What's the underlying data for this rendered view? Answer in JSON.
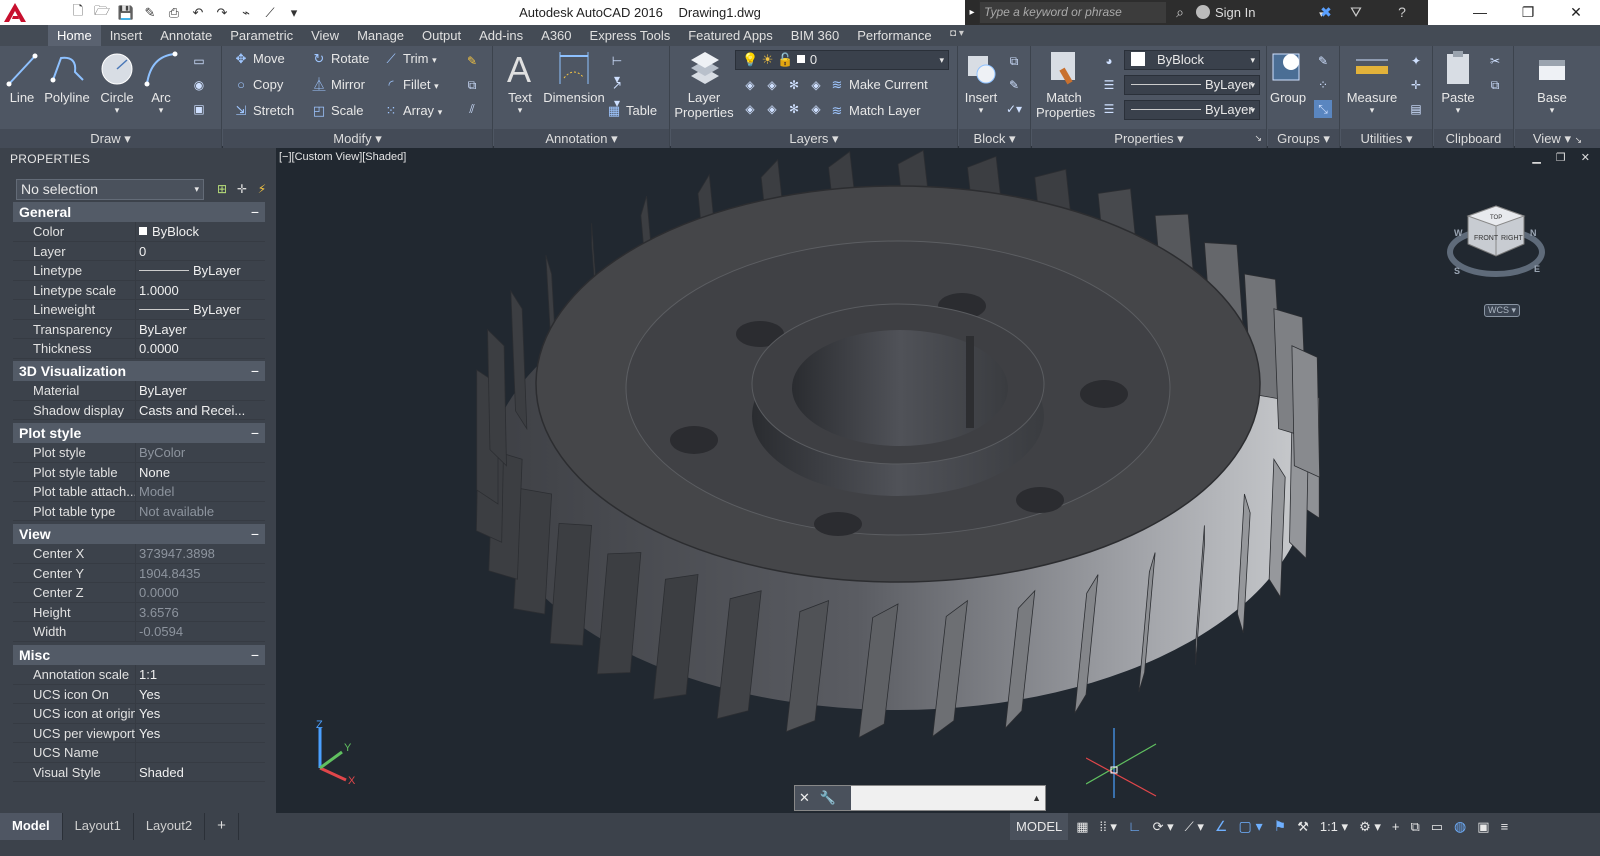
{
  "titlebar": {
    "app_name": "Autodesk AutoCAD 2016",
    "document": "Drawing1.dwg",
    "search_placeholder": "Type a keyword or phrase",
    "sign_in": "Sign In"
  },
  "ribbon_tabs": [
    "Home",
    "Insert",
    "Annotate",
    "Parametric",
    "View",
    "Manage",
    "Output",
    "Add-ins",
    "A360",
    "Express Tools",
    "Featured Apps",
    "BIM 360",
    "Performance"
  ],
  "ribbon": {
    "draw": {
      "title": "Draw",
      "line": "Line",
      "polyline": "Polyline",
      "circle": "Circle",
      "arc": "Arc"
    },
    "modify": {
      "title": "Modify",
      "move": "Move",
      "rotate": "Rotate",
      "trim": "Trim",
      "copy": "Copy",
      "mirror": "Mirror",
      "fillet": "Fillet",
      "stretch": "Stretch",
      "scale": "Scale",
      "array": "Array"
    },
    "annotation": {
      "title": "Annotation",
      "text": "Text",
      "dimension": "Dimension",
      "table": "Table"
    },
    "layers": {
      "title": "Layers",
      "layer_properties_1": "Layer",
      "layer_properties_2": "Properties",
      "current_layer": "0",
      "make_current": "Make Current",
      "match_layer": "Match Layer"
    },
    "block": {
      "title": "Block",
      "insert": "Insert"
    },
    "properties": {
      "title": "Properties",
      "match_1": "Match",
      "match_2": "Properties",
      "color": "ByBlock",
      "linetype": "ByLayer",
      "lineweight": "ByLayer"
    },
    "groups": {
      "title": "Groups",
      "group": "Group"
    },
    "utilities": {
      "title": "Utilities",
      "measure": "Measure"
    },
    "clipboard": {
      "title": "Clipboard",
      "paste": "Paste"
    },
    "view": {
      "title": "View",
      "base": "Base"
    }
  },
  "properties": {
    "header": "PROPERTIES",
    "selection": "No selection",
    "sections": {
      "general": "General",
      "visualization": "3D Visualization",
      "plot_style": "Plot style",
      "view": "View",
      "misc": "Misc"
    },
    "general": [
      {
        "name": "Color",
        "value": "ByBlock"
      },
      {
        "name": "Layer",
        "value": "0"
      },
      {
        "name": "Linetype",
        "value": "ByLayer"
      },
      {
        "name": "Linetype scale",
        "value": "1.0000"
      },
      {
        "name": "Lineweight",
        "value": "ByLayer"
      },
      {
        "name": "Transparency",
        "value": "ByLayer"
      },
      {
        "name": "Thickness",
        "value": "0.0000"
      }
    ],
    "visualization": [
      {
        "name": "Material",
        "value": "ByLayer"
      },
      {
        "name": "Shadow display",
        "value": "Casts and Recei..."
      }
    ],
    "plot_style": [
      {
        "name": "Plot style",
        "value": "ByColor"
      },
      {
        "name": "Plot style table",
        "value": "None"
      },
      {
        "name": "Plot table attach...",
        "value": "Model"
      },
      {
        "name": "Plot table type",
        "value": "Not available"
      }
    ],
    "view": [
      {
        "name": "Center X",
        "value": "373947.3898"
      },
      {
        "name": "Center Y",
        "value": "1904.8435"
      },
      {
        "name": "Center Z",
        "value": "0.0000"
      },
      {
        "name": "Height",
        "value": "3.6576"
      },
      {
        "name": "Width",
        "value": "-0.0594"
      }
    ],
    "misc": [
      {
        "name": "Annotation scale",
        "value": "1:1"
      },
      {
        "name": "UCS icon On",
        "value": "Yes"
      },
      {
        "name": "UCS icon at origin",
        "value": "Yes"
      },
      {
        "name": "UCS per viewport",
        "value": "Yes"
      },
      {
        "name": "UCS Name",
        "value": ""
      },
      {
        "name": "Visual Style",
        "value": "Shaded"
      }
    ]
  },
  "viewport": {
    "label": "[−][Custom View][Shaded]",
    "wcs": "WCS",
    "viewcube": {
      "top": "TOP",
      "front": "FRONT",
      "right": "RIGHT",
      "n": "N",
      "s": "S",
      "e": "E",
      "w": "W"
    },
    "ucs_axes": {
      "x": "X",
      "y": "Y",
      "z": "Z"
    }
  },
  "statusbar": {
    "tabs": [
      "Model",
      "Layout1",
      "Layout2"
    ],
    "model_label": "MODEL",
    "scale": "1:1"
  },
  "colors": {
    "viewport_bg": "#212830",
    "ribbon_bg": "#4e5663",
    "panel_bg": "#3c424b",
    "accent": "#6fb0ff",
    "logo_red": "#c8102e"
  }
}
